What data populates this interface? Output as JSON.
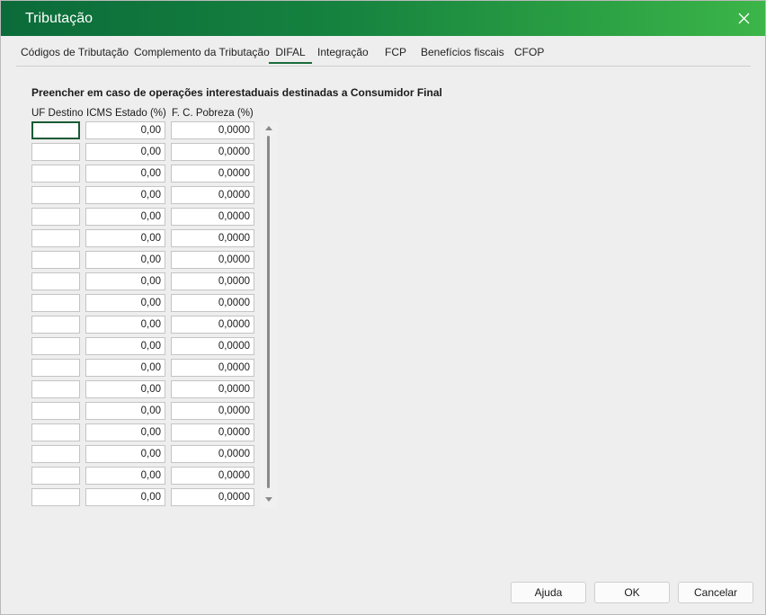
{
  "window": {
    "title": "Tributação"
  },
  "tabs": [
    {
      "label": "Códigos de Tributação"
    },
    {
      "label": "Complemento da Tributação"
    },
    {
      "label": "DIFAL",
      "active": true
    },
    {
      "label": "Integração"
    },
    {
      "label": "FCP"
    },
    {
      "label": "Benefícios fiscais"
    },
    {
      "label": "CFOP"
    }
  ],
  "section": {
    "heading": "Preencher em caso de operações interestaduais destinadas a Consumidor Final"
  },
  "table": {
    "headers": {
      "uf": "UF Destino",
      "icms": "ICMS Estado (%)",
      "fcp": "F. C. Pobreza (%)"
    },
    "rows": [
      {
        "uf": "",
        "icms": "0,00",
        "fcp": "0,0000"
      },
      {
        "uf": "",
        "icms": "0,00",
        "fcp": "0,0000"
      },
      {
        "uf": "",
        "icms": "0,00",
        "fcp": "0,0000"
      },
      {
        "uf": "",
        "icms": "0,00",
        "fcp": "0,0000"
      },
      {
        "uf": "",
        "icms": "0,00",
        "fcp": "0,0000"
      },
      {
        "uf": "",
        "icms": "0,00",
        "fcp": "0,0000"
      },
      {
        "uf": "",
        "icms": "0,00",
        "fcp": "0,0000"
      },
      {
        "uf": "",
        "icms": "0,00",
        "fcp": "0,0000"
      },
      {
        "uf": "",
        "icms": "0,00",
        "fcp": "0,0000"
      },
      {
        "uf": "",
        "icms": "0,00",
        "fcp": "0,0000"
      },
      {
        "uf": "",
        "icms": "0,00",
        "fcp": "0,0000"
      },
      {
        "uf": "",
        "icms": "0,00",
        "fcp": "0,0000"
      },
      {
        "uf": "",
        "icms": "0,00",
        "fcp": "0,0000"
      },
      {
        "uf": "",
        "icms": "0,00",
        "fcp": "0,0000"
      },
      {
        "uf": "",
        "icms": "0,00",
        "fcp": "0,0000"
      },
      {
        "uf": "",
        "icms": "0,00",
        "fcp": "0,0000"
      },
      {
        "uf": "",
        "icms": "0,00",
        "fcp": "0,0000"
      },
      {
        "uf": "",
        "icms": "0,00",
        "fcp": "0,0000"
      }
    ]
  },
  "buttons": {
    "help": "Ajuda",
    "ok": "OK",
    "cancel": "Cancelar"
  },
  "icons": {
    "close": "close-icon",
    "scroll_up": "arrow-up-icon",
    "scroll_down": "arrow-down-icon"
  },
  "colors": {
    "titlebar_start": "#0b6b3a",
    "titlebar_end": "#3cb549",
    "accent": "#1a6b3a"
  }
}
